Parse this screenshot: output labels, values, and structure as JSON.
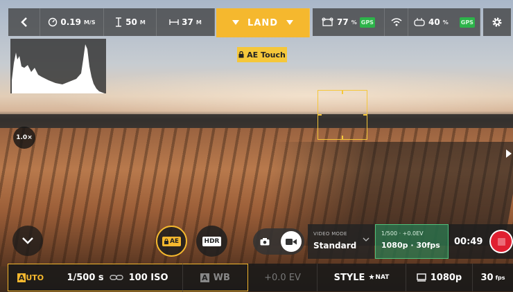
{
  "topbar": {
    "speed": "0.19",
    "speed_unit": "M/S",
    "altitude": "50",
    "altitude_unit": "M",
    "distance": "37",
    "distance_unit": "M",
    "land_label": "LAND",
    "drone_battery": "77",
    "drone_battery_unit": "%",
    "gps_label": "GPS",
    "device_battery": "40",
    "device_battery_unit": "%",
    "gps2_label": "GPS"
  },
  "overlay": {
    "ae_touch_label": "AE Touch",
    "zoom_label": "1.0×"
  },
  "controls": {
    "ae_lock_label": "AE",
    "hdr_label": "HDR",
    "video_mode_caption": "VIDEO MODE",
    "video_mode_value": "Standard",
    "rec_info_top": "1/500 · +0.0EV",
    "rec_info_bottom": "1080p · 30fps",
    "rec_time": "00:49"
  },
  "bottombar": {
    "auto_letter": "A",
    "auto_rest": "UTO",
    "shutter": "1/500 s",
    "iso": "100 ISO",
    "wb_letter": "A",
    "wb_label": "WB",
    "ev": "+0.0 EV",
    "style_label": "STYLE",
    "style_value": "NAT",
    "resolution": "1080p",
    "fps": "30",
    "fps_unit": "fps"
  },
  "colors": {
    "accent": "#f5b82e",
    "gps": "#2db34a",
    "record": "#e02030",
    "rec_panel": "#2e8b57"
  }
}
